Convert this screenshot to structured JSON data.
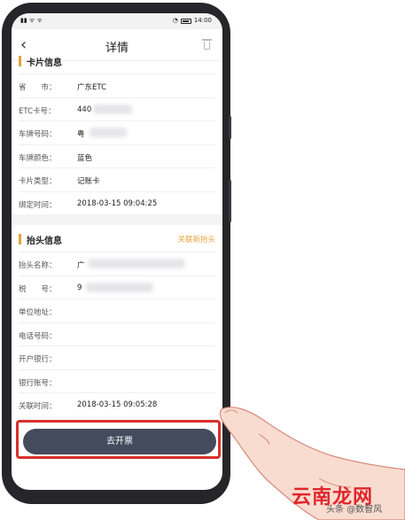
{
  "status_bar": {
    "carrier_icons": "▮▮ ᯤ ᯤ",
    "time": "14:00"
  },
  "nav": {
    "title": "详情",
    "back_icon": "chevron-left-icon",
    "delete_icon": "trash-icon"
  },
  "card_section": {
    "title": "卡片信息",
    "rows": [
      {
        "label": "省　　市：",
        "value": "广东ETC"
      },
      {
        "label": "ETC卡号：",
        "value": "440"
      },
      {
        "label": "车牌号码：",
        "value": "粤"
      },
      {
        "label": "车牌颜色：",
        "value": "蓝色"
      },
      {
        "label": "卡片类型：",
        "value": "记账卡"
      },
      {
        "label": "绑定时间：",
        "value": "2018-03-15 09:04:25"
      }
    ]
  },
  "invoice_section": {
    "title": "抬头信息",
    "link": "关联新抬头",
    "rows": [
      {
        "label": "抬头名称：",
        "value": "广"
      },
      {
        "label": "税　　号：",
        "value": "9"
      },
      {
        "label": "单位地址：",
        "value": ""
      },
      {
        "label": "电话号码：",
        "value": ""
      },
      {
        "label": "开户银行：",
        "value": ""
      },
      {
        "label": "银行账号：",
        "value": ""
      },
      {
        "label": "关联时间：",
        "value": "2018-03-15 09:05:28"
      }
    ]
  },
  "cta": {
    "label": "去开票"
  },
  "watermark": {
    "brand": "云南龙网",
    "source": "头条 @数智风"
  },
  "colors": {
    "accent": "#e6a23c",
    "button": "#444b5c",
    "highlight": "#d9302b"
  }
}
